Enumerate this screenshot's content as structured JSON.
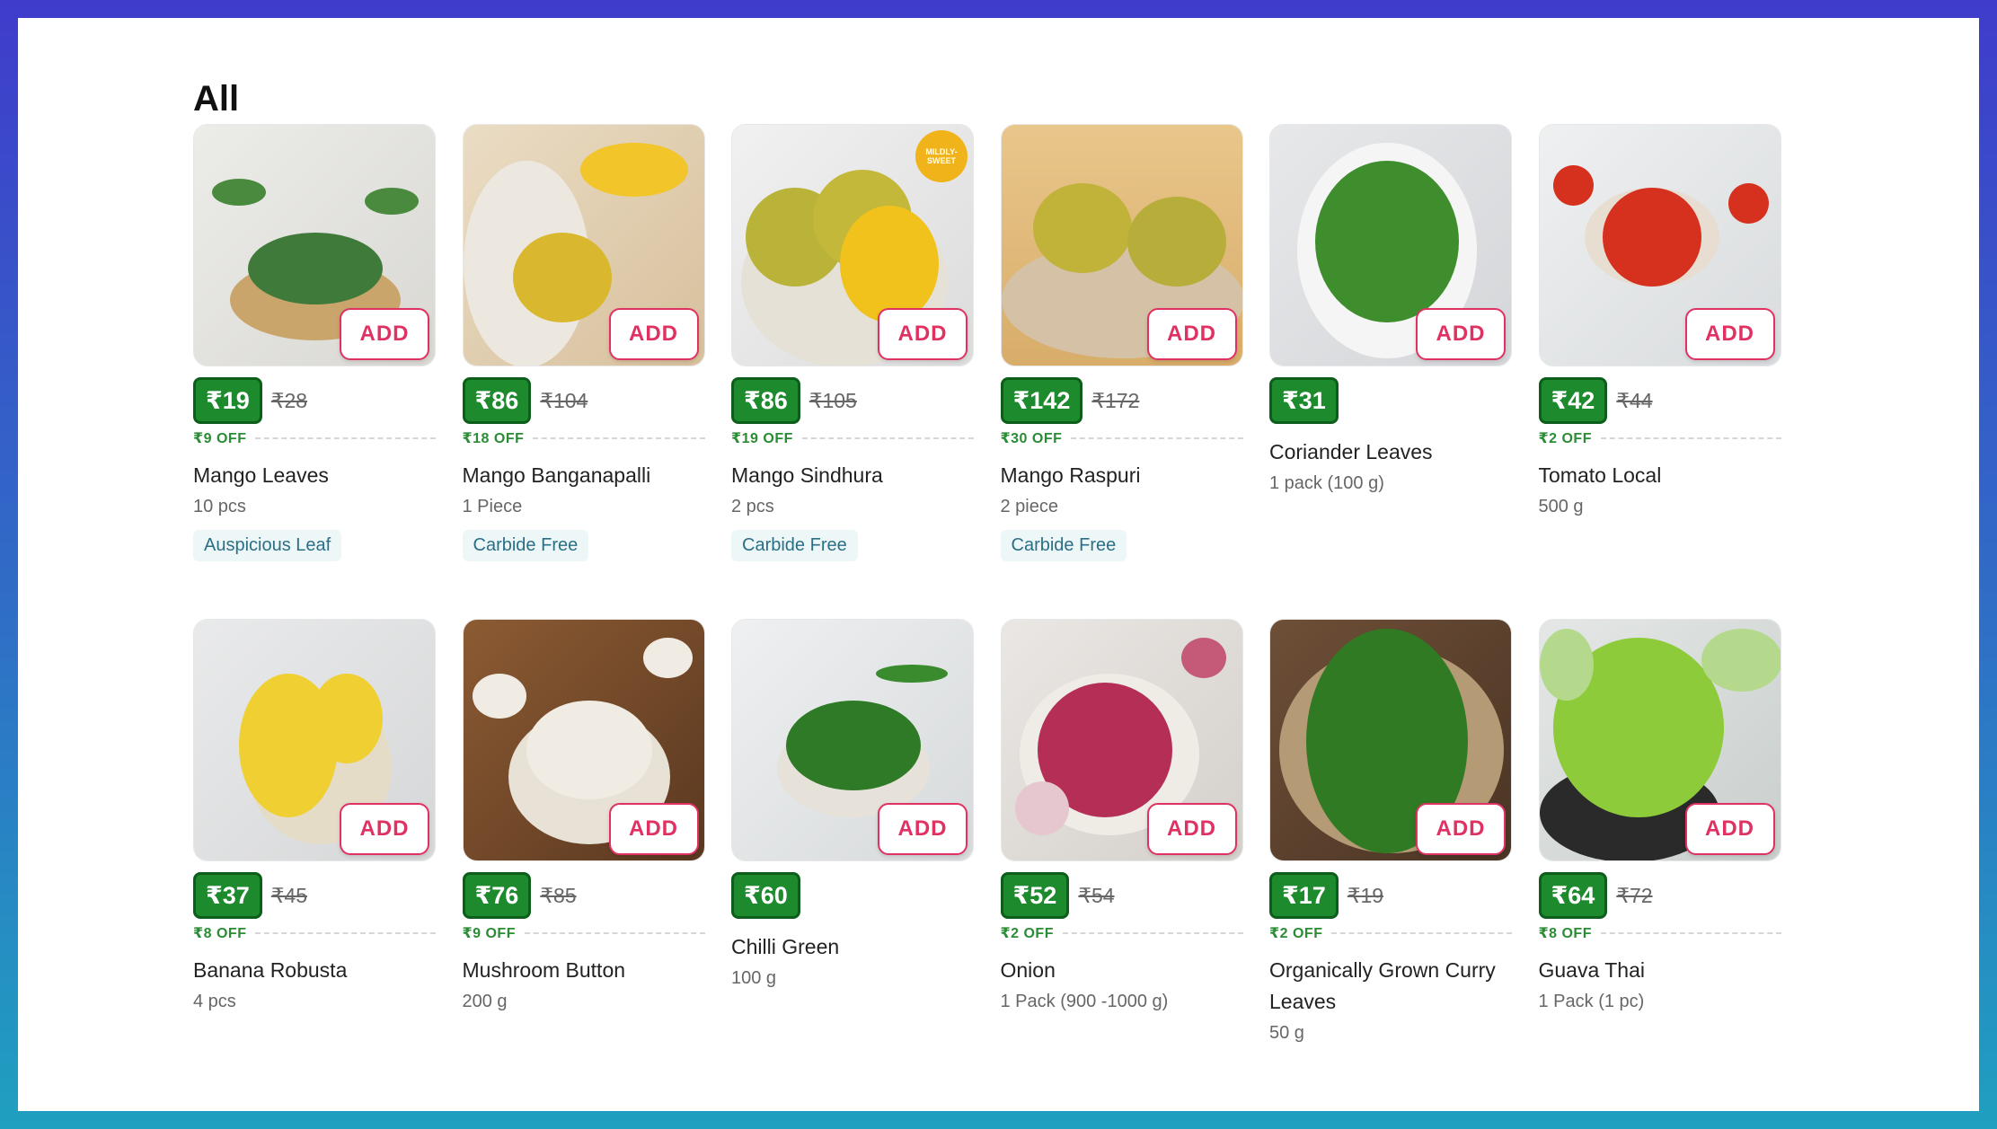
{
  "section_title": "All",
  "add_label": "ADD",
  "colors": {
    "brand_pink": "#e03262",
    "price_green": "#1e8a2e",
    "off_green": "#2a8c34"
  },
  "products": [
    {
      "name": "Mango Leaves",
      "price": "₹19",
      "mrp": "₹28",
      "off": "₹9 OFF",
      "qty": "10 pcs",
      "tag": "Auspicious Leaf",
      "image": "mango-leaves-image"
    },
    {
      "name": "Mango Banganapalli",
      "price": "₹86",
      "mrp": "₹104",
      "off": "₹18 OFF",
      "qty": "1 Piece",
      "tag": "Carbide Free",
      "image": "mango-banganapalli-image"
    },
    {
      "name": "Mango Sindhura",
      "price": "₹86",
      "mrp": "₹105",
      "off": "₹19 OFF",
      "qty": "2 pcs",
      "tag": "Carbide Free",
      "image": "mango-sindhura-image",
      "badge": "MILDLY-SWEET"
    },
    {
      "name": "Mango Raspuri",
      "price": "₹142",
      "mrp": "₹172",
      "off": "₹30 OFF",
      "qty": "2 piece",
      "tag": "Carbide Free",
      "image": "mango-raspuri-image"
    },
    {
      "name": "Coriander Leaves",
      "price": "₹31",
      "qty": "1 pack (100 g)",
      "image": "coriander-image"
    },
    {
      "name": "Tomato Local",
      "price": "₹42",
      "mrp": "₹44",
      "off": "₹2 OFF",
      "qty": "500 g",
      "image": "tomato-image"
    },
    {
      "name": "Banana Robusta",
      "price": "₹37",
      "mrp": "₹45",
      "off": "₹8 OFF",
      "qty": "4 pcs",
      "image": "banana-image"
    },
    {
      "name": "Mushroom Button",
      "price": "₹76",
      "mrp": "₹85",
      "off": "₹9 OFF",
      "qty": "200 g",
      "image": "mushroom-image"
    },
    {
      "name": "Chilli Green",
      "price": "₹60",
      "qty": "100 g",
      "image": "chilli-image"
    },
    {
      "name": "Onion",
      "price": "₹52",
      "mrp": "₹54",
      "off": "₹2 OFF",
      "qty": "1 Pack (900 -1000 g)",
      "image": "onion-image"
    },
    {
      "name": "Organically Grown Curry Leaves",
      "price": "₹17",
      "mrp": "₹19",
      "off": "₹2 OFF",
      "qty": "50 g",
      "image": "curry-leaves-image"
    },
    {
      "name": "Guava Thai",
      "price": "₹64",
      "mrp": "₹72",
      "off": "₹8 OFF",
      "qty": "1 Pack (1 pc)",
      "image": "guava-image"
    }
  ]
}
